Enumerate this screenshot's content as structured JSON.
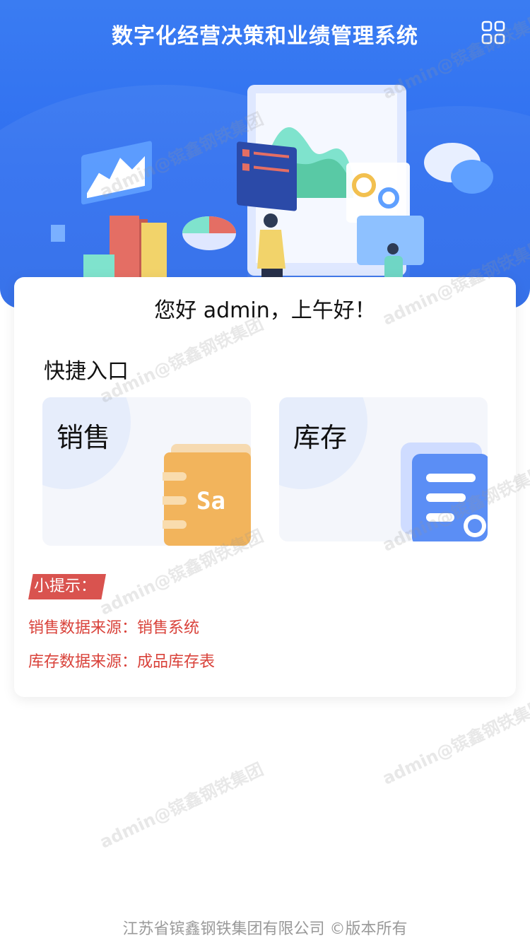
{
  "header": {
    "title": "数字化经营决策和业绩管理系统",
    "menu_icon": "grid-menu-icon"
  },
  "main": {
    "greeting": "您好 admin，上午好！",
    "quick_entry_title": "快捷入口",
    "entries": [
      {
        "label": "销售",
        "icon": "sales-notebook-icon",
        "icon_text": "Sa"
      },
      {
        "label": "库存",
        "icon": "inventory-document-icon"
      }
    ],
    "tips": {
      "badge": "小提示：",
      "lines": [
        "销售数据来源：销售系统",
        "库存数据来源：成品库存表"
      ]
    }
  },
  "footer": {
    "text": "江苏省镔鑫钢铁集团有限公司 ©版本所有"
  },
  "watermark": {
    "text": "admin@镔鑫钢铁集团"
  },
  "colors": {
    "header_blue": "#2f6ff0",
    "tip_red": "#d9534f",
    "tip_text": "#d9423a",
    "card_bg": "#f4f6fb"
  }
}
